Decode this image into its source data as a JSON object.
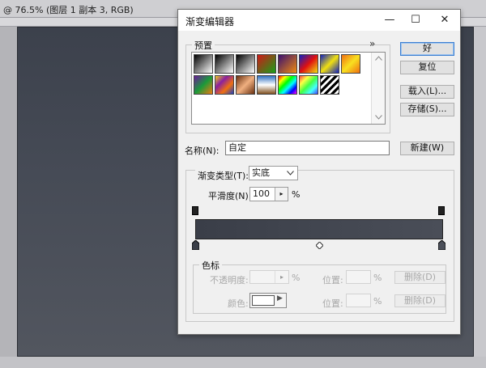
{
  "document": {
    "tab_title": "@ 76.5% (图层 1 副本 3, RGB)"
  },
  "dialog": {
    "title": "渐变编辑器",
    "window_controls": {
      "minimize": "—",
      "maximize": "☐",
      "close": "✕"
    },
    "presets": {
      "label": "预置",
      "menu_glyph": "»",
      "swatches": [
        {
          "name": "foreground-to-background",
          "css": "linear-gradient(135deg,#000,#fff)"
        },
        {
          "name": "foreground-to-transparent",
          "css": "linear-gradient(135deg,#000,rgba(0,0,0,0))"
        },
        {
          "name": "black-white",
          "css": "linear-gradient(135deg,#000,#fff)"
        },
        {
          "name": "red-green",
          "css": "linear-gradient(135deg,#d01818,#18a018)"
        },
        {
          "name": "violet-orange",
          "css": "linear-gradient(135deg,#3a1070,#f08a10)"
        },
        {
          "name": "blue-red-yellow",
          "css": "linear-gradient(135deg,#1020c0,#e01010,#f0e010)"
        },
        {
          "name": "blue-yellow-blue",
          "css": "linear-gradient(135deg,#1020c0,#f0e010,#1020c0)"
        },
        {
          "name": "orange-yellow-orange",
          "css": "linear-gradient(135deg,#f07010,#f8e020,#f07010)"
        },
        {
          "name": "violet-green-orange",
          "css": "linear-gradient(135deg,#6a1a9a,#1a9a3a,#f07a10)"
        },
        {
          "name": "yellow-violet-orange-blue",
          "css": "linear-gradient(135deg,#f0d020,#8a20a0,#f07010,#2040c0)"
        },
        {
          "name": "copper",
          "css": "linear-gradient(135deg,#6a3010,#f0b080,#6a3010)"
        },
        {
          "name": "chrome",
          "css": "linear-gradient(180deg,#3070c0,#ffffff 50%,#805020)"
        },
        {
          "name": "spectrum",
          "css": "linear-gradient(135deg,#f00,#ff0,#0f0,#0ff,#00f,#f0f)"
        },
        {
          "name": "transparent-rainbow",
          "css": "linear-gradient(135deg,#f44,#ff4,#4f4,#4ff,#44f)"
        },
        {
          "name": "transparent-stripes",
          "css": "repeating-linear-gradient(135deg,#000 0 3px,#fff 3px 6px)"
        }
      ]
    },
    "buttons": {
      "ok": "好",
      "reset": "复位",
      "load": "载入(L)...",
      "save": "存储(S)...",
      "new": "新建(W)"
    },
    "name_field": {
      "label": "名称(N):",
      "value": "自定"
    },
    "gradient_type": {
      "label": "渐变类型(T):",
      "value": "实底"
    },
    "smoothness": {
      "label": "平滑度(N):",
      "value": "100",
      "unit": "%"
    },
    "color_stops": {
      "label": "色标",
      "opacity_label": "不透明度:",
      "opacity_unit": "%",
      "location_label": "位置:",
      "location_unit": "%",
      "delete_label": "删除(D)",
      "color_label": "颜色:"
    },
    "colors": {
      "gradient_start": "#3a3e48",
      "gradient_end": "#4a4e58",
      "accent": "#3c7fd1"
    }
  }
}
